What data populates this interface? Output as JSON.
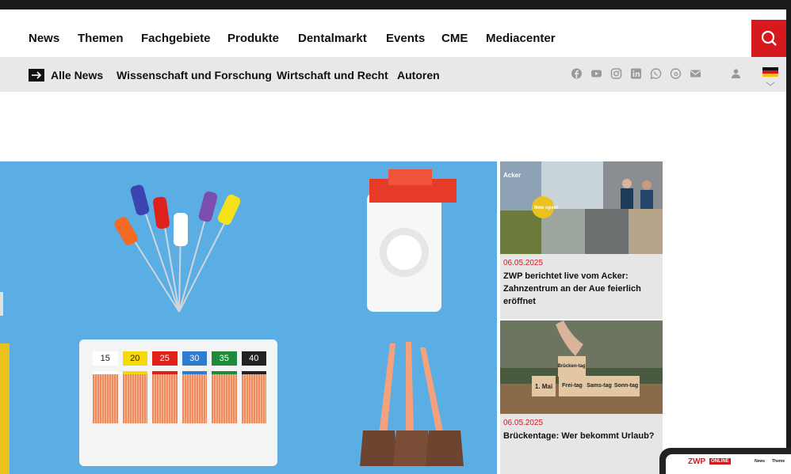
{
  "nav": {
    "items": [
      "News",
      "Themen",
      "Fachgebiete",
      "Produkte",
      "Dentalmarkt",
      "Events",
      "CME",
      "Mediacenter"
    ]
  },
  "subnav": {
    "items": [
      "Alle News",
      "Wissenschaft und Forschung",
      "Wirtschaft und Recht",
      "Autoren"
    ]
  },
  "hero": {
    "strip_labels": [
      "15",
      "20",
      "25",
      "30",
      "35",
      "40"
    ],
    "strip_colors": [
      "#ffffff",
      "#f5d90a",
      "#e0201b",
      "#2c7dd0",
      "#1f8a3a",
      "#222222"
    ]
  },
  "articles": [
    {
      "date": "06.05.2025",
      "title": "ZWP berichtet live vom Acker: Zahnzentrum an der Aue feierlich eröffnet",
      "image_text": [
        "Acker",
        "New open!"
      ]
    },
    {
      "date": "06.05.2025",
      "title": "Brückentage: Wer bekommt Urlaub?",
      "image_text": [
        "Brücken-tag",
        "1. Mai",
        "Frei-tag",
        "Sams-tag",
        "Sonn-tag"
      ]
    }
  ],
  "tablet": {
    "logo": "ZWP",
    "logo_badge": "ONLINE",
    "nav": [
      "News",
      "Theme"
    ]
  },
  "colors": {
    "accent": "#d6181f",
    "subnav_bg": "#e8e8e8",
    "hero_bg": "#5aaee4"
  }
}
